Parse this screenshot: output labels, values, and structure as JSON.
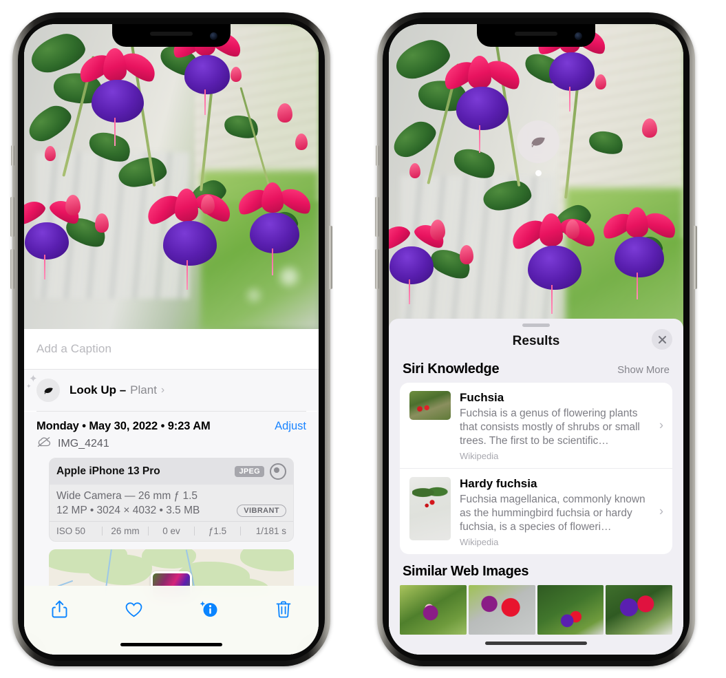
{
  "left_phone": {
    "caption": {
      "placeholder": "Add a Caption",
      "value": ""
    },
    "look_up": {
      "icon": "leaf-icon",
      "label": "Look Up –",
      "subject": "Plant",
      "chevron": "›"
    },
    "date_row": {
      "date": "Monday • May 30, 2022 • 9:23 AM",
      "adjust_label": "Adjust"
    },
    "file_row": {
      "icon": "cloud-slash-icon",
      "filename": "IMG_4241"
    },
    "camera_card": {
      "model": "Apple iPhone 13 Pro",
      "format_badge": "JPEG",
      "lens_icon": "aperture-icon",
      "lens_line": "Wide Camera — 26 mm ƒ 1.5",
      "size_line": "12 MP • 3024 × 4032 • 3.5 MB",
      "profile_badge": "VIBRANT",
      "exif": [
        "ISO 50",
        "26 mm",
        "0 ev",
        "ƒ1.5",
        "1/181 s"
      ]
    },
    "toolbar": [
      {
        "name": "share-icon",
        "label": "Share"
      },
      {
        "name": "favorite-heart-icon",
        "label": "Favorite"
      },
      {
        "name": "info-sparkle-icon",
        "label": "Info"
      },
      {
        "name": "trash-icon",
        "label": "Delete"
      }
    ]
  },
  "right_phone": {
    "badge": {
      "icon": "leaf-icon",
      "name": "visual-look-up-badge"
    },
    "sheet": {
      "title": "Results",
      "close_icon": "close-icon",
      "sections": [
        {
          "title": "Siri Knowledge",
          "action_label": "Show More",
          "items": [
            {
              "title": "Fuchsia",
              "description": "Fuchsia is a genus of flowering plants that consists mostly of shrubs or small trees. The first to be scientific…",
              "source": "Wikipedia"
            },
            {
              "title": "Hardy fuchsia",
              "description": "Fuchsia magellanica, commonly known as the hummingbird fuchsia or hardy fuchsia, is a species of floweri…",
              "source": "Wikipedia"
            }
          ]
        },
        {
          "title": "Similar Web Images",
          "images": [
            "fuchsia-web-image-1",
            "fuchsia-web-image-2",
            "fuchsia-web-image-3",
            "fuchsia-web-image-4"
          ]
        }
      ]
    }
  },
  "colors": {
    "accent_blue": "#0a84ff",
    "sheet_bg": "#f0eff4",
    "card_bg": "#ffffff",
    "secondary_text": "#7d7d84"
  }
}
